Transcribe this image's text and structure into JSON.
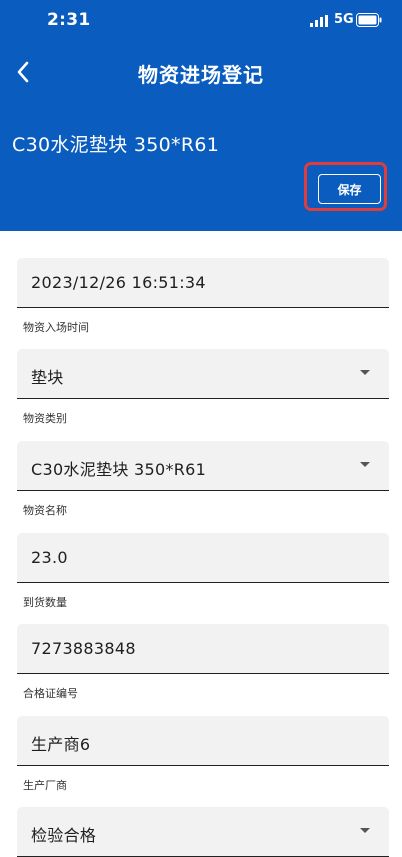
{
  "status_bar": {
    "time": "2:31",
    "network": "5G"
  },
  "header": {
    "title": "物资进场登记",
    "material_title": "C30水泥垫块 350*R61",
    "save_label": "保存"
  },
  "fields": [
    {
      "value": "2023/12/26 16:51:34",
      "label": "物资入场时间",
      "dropdown": false
    },
    {
      "value": "垫块",
      "label": "物资类别",
      "dropdown": true
    },
    {
      "value": "C30水泥垫块 350*R61",
      "label": "物资名称",
      "dropdown": true
    },
    {
      "value": "23.0",
      "label": "到货数量",
      "dropdown": false
    },
    {
      "value": "7273883848",
      "label": "合格证编号",
      "dropdown": false
    },
    {
      "value": "生产商6",
      "label": "生产厂商",
      "dropdown": false
    },
    {
      "value": "检验合格",
      "label": "",
      "dropdown": true
    }
  ],
  "colors": {
    "header_bg": "#0a5cbf",
    "highlight": "#e03c3c",
    "field_bg": "#f2f2f2"
  }
}
